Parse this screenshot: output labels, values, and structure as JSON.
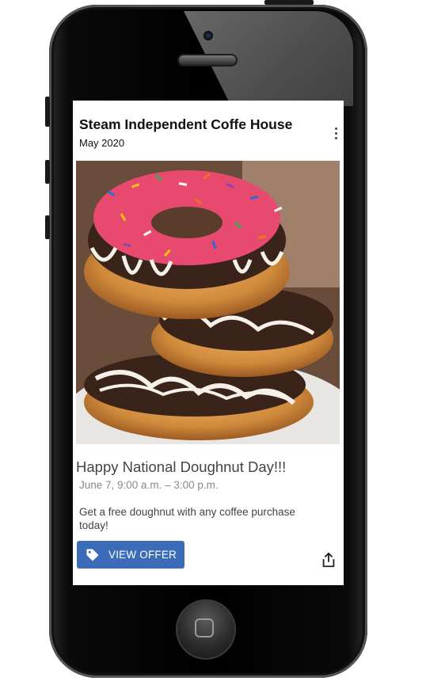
{
  "post": {
    "business_name": "Steam Independent Coffe House",
    "posted_date": "May 2020",
    "headline": "Happy National Doughnut Day!!!",
    "event_time": "June 7, 9:00 a.m. – 3:00 p.m.",
    "description": "Get a free doughnut with any coffee purchase today!"
  },
  "actions": {
    "view_offer_label": "VIEW OFFER",
    "view_offer_color": "#3c6cb8",
    "view_offer_icon": "tag-icon",
    "share_icon": "share-icon",
    "more_icon": "more-vertical-icon"
  },
  "photo": {
    "subject": "doughnut-stack-image"
  }
}
